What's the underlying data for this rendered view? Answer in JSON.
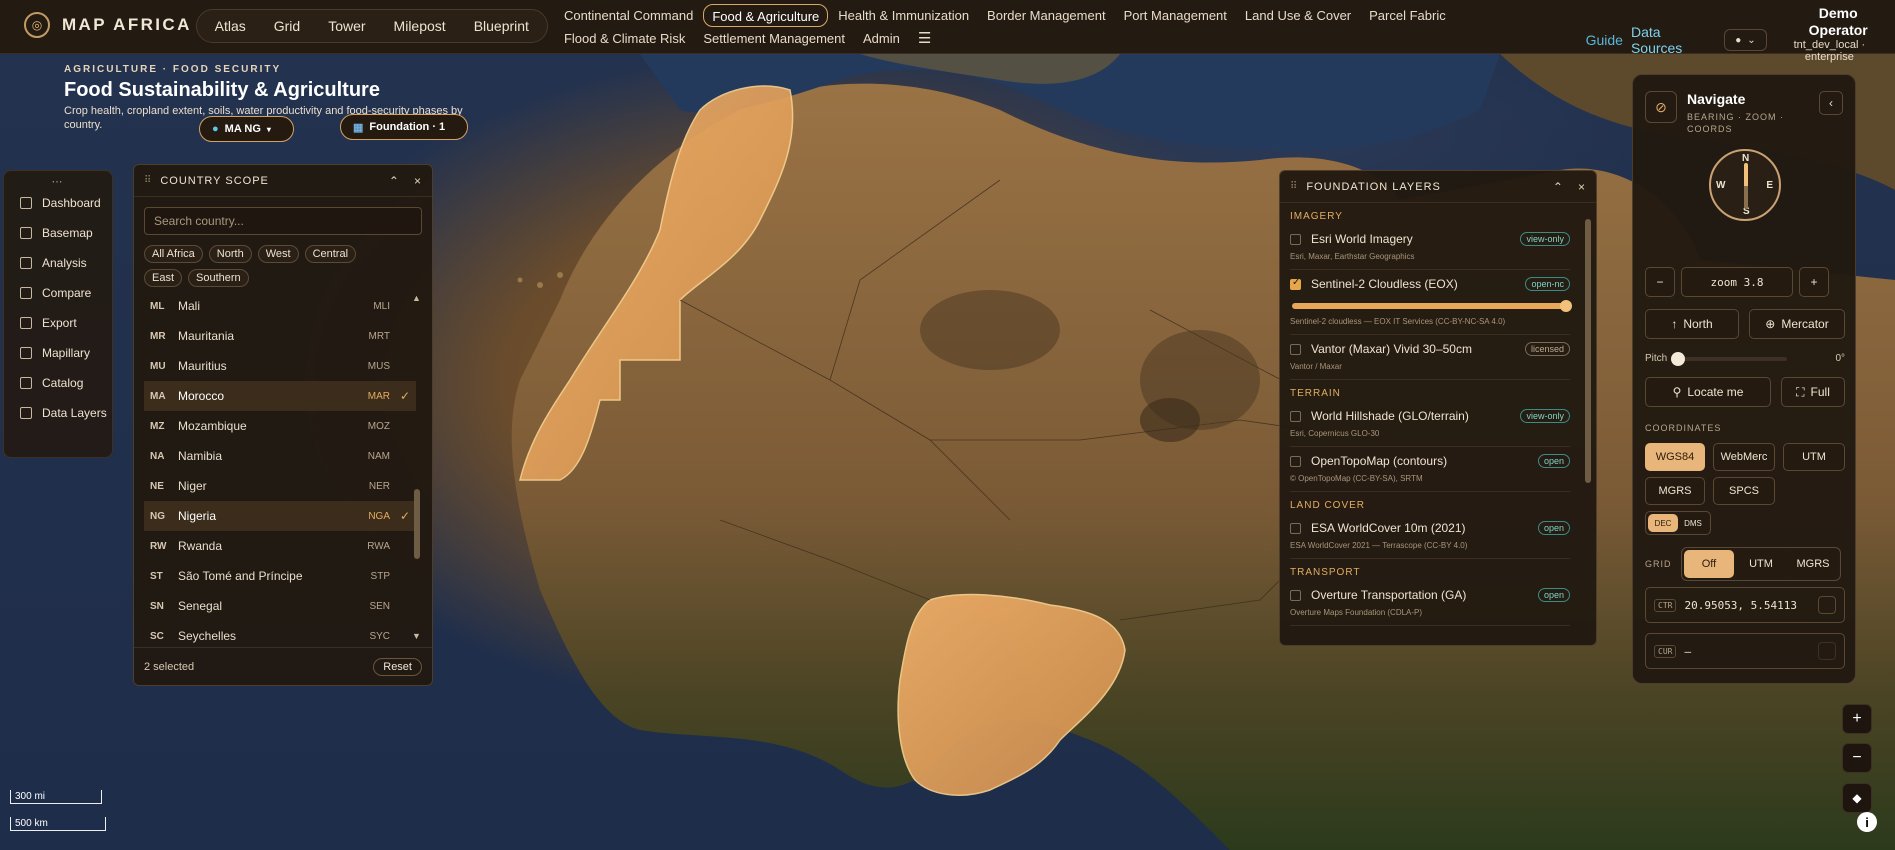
{
  "brand": {
    "title": "MAP AFRICA"
  },
  "topnav": {
    "pills": [
      "Atlas",
      "Grid",
      "Tower",
      "Milepost",
      "Blueprint"
    ],
    "tabs": [
      "Continental Command",
      "Food & Agriculture",
      "Health & Immunization",
      "Border Management",
      "Port Management",
      "Land Use & Cover",
      "Parcel Fabric",
      "Flood & Climate Risk",
      "Settlement Management",
      "Admin"
    ],
    "active_tab": "Food & Agriculture",
    "menu_icon": "hamburger-icon",
    "guide": "Guide",
    "data_sources": "Data Sources",
    "user_name": "Demo Operator",
    "user_org": "tnt_dev_local · enterprise"
  },
  "page": {
    "kicker": "AGRICULTURE · FOOD SECURITY",
    "title": "Food Sustainability & Agriculture",
    "subtitle": "Crop health, cropland extent, soils, water productivity and food-security phases by country.",
    "chip_scope": "MA NG",
    "chip_foundation": "Foundation · 1"
  },
  "rail": {
    "items": [
      {
        "label": "Dashboard",
        "icon": "dashboard-icon"
      },
      {
        "label": "Basemap",
        "icon": "basemap-icon"
      },
      {
        "label": "Analysis",
        "icon": "analysis-icon"
      },
      {
        "label": "Compare",
        "icon": "compare-icon"
      },
      {
        "label": "Export",
        "icon": "export-icon"
      },
      {
        "label": "Mapillary",
        "icon": "camera-icon"
      },
      {
        "label": "Catalog",
        "icon": "catalog-icon"
      },
      {
        "label": "Data Layers",
        "icon": "layers-icon"
      }
    ]
  },
  "scope": {
    "title": "COUNTRY SCOPE",
    "search_placeholder": "Search country...",
    "filters": [
      "All Africa",
      "North",
      "West",
      "Central",
      "East",
      "Southern"
    ],
    "countries": [
      {
        "code": "ML",
        "name": "Mali",
        "iso": "MLI",
        "selected": false
      },
      {
        "code": "MR",
        "name": "Mauritania",
        "iso": "MRT",
        "selected": false
      },
      {
        "code": "MU",
        "name": "Mauritius",
        "iso": "MUS",
        "selected": false
      },
      {
        "code": "MA",
        "name": "Morocco",
        "iso": "MAR",
        "selected": true
      },
      {
        "code": "MZ",
        "name": "Mozambique",
        "iso": "MOZ",
        "selected": false
      },
      {
        "code": "NA",
        "name": "Namibia",
        "iso": "NAM",
        "selected": false
      },
      {
        "code": "NE",
        "name": "Niger",
        "iso": "NER",
        "selected": false
      },
      {
        "code": "NG",
        "name": "Nigeria",
        "iso": "NGA",
        "selected": true
      },
      {
        "code": "RW",
        "name": "Rwanda",
        "iso": "RWA",
        "selected": false
      },
      {
        "code": "ST",
        "name": "São Tomé and Príncipe",
        "iso": "STP",
        "selected": false
      },
      {
        "code": "SN",
        "name": "Senegal",
        "iso": "SEN",
        "selected": false
      },
      {
        "code": "SC",
        "name": "Seychelles",
        "iso": "SYC",
        "selected": false
      }
    ],
    "check_mark": "✓",
    "selected_count": "2 selected",
    "reset": "Reset"
  },
  "layers": {
    "title": "FOUNDATION LAYERS",
    "sections": [
      {
        "name": "IMAGERY",
        "items": [
          {
            "name": "Esri World Imagery",
            "tag": "view-only",
            "attribution": "Esri, Maxar, Earthstar Geographics",
            "checked": false
          },
          {
            "name": "Sentinel-2 Cloudless (EOX)",
            "tag": "open-nc",
            "attribution": "Sentinel-2 cloudless — EOX IT Services (CC-BY-NC-SA 4.0)",
            "checked": true,
            "opacity": 1
          },
          {
            "name": "Vantor (Maxar) Vivid 30–50cm",
            "tag": "licensed",
            "attribution": "Vantor / Maxar",
            "checked": false
          }
        ]
      },
      {
        "name": "TERRAIN",
        "items": [
          {
            "name": "World Hillshade (GLO/terrain)",
            "tag": "view-only",
            "attribution": "Esri, Copernicus GLO-30",
            "checked": false
          },
          {
            "name": "OpenTopoMap (contours)",
            "tag": "open",
            "attribution": "© OpenTopoMap (CC-BY-SA), SRTM",
            "checked": false
          }
        ]
      },
      {
        "name": "LAND COVER",
        "items": [
          {
            "name": "ESA WorldCover 10m (2021)",
            "tag": "open",
            "attribution": "ESA WorldCover 2021 — Terrascope (CC-BY 4.0)",
            "checked": false
          }
        ]
      },
      {
        "name": "TRANSPORT",
        "items": [
          {
            "name": "Overture Transportation (GA)",
            "tag": "open",
            "attribution": "Overture Maps Foundation (CDLA-P)",
            "checked": false
          }
        ]
      }
    ]
  },
  "navigate": {
    "title": "Navigate",
    "subtitle": "BEARING · ZOOM · COORDS",
    "compass": {
      "n": "N",
      "s": "S",
      "e": "E",
      "w": "W"
    },
    "zoom_label": "zoom 3.8",
    "north": "North",
    "projection": "Mercator",
    "pitch_label": "Pitch",
    "pitch_value": "0°",
    "pitch": 0,
    "locate": "Locate me",
    "full": "Full",
    "coords_label": "COORDINATES",
    "coord_systems": [
      "WGS84",
      "WebMerc",
      "UTM",
      "MGRS",
      "SPCS"
    ],
    "coord_active": "WGS84",
    "format": [
      "DEC",
      "DMS"
    ],
    "format_active": "DEC",
    "grid_label": "GRID",
    "grid_options": [
      "Off",
      "UTM",
      "MGRS"
    ],
    "grid_active": "Off",
    "ctr_label": "CTR",
    "ctr_value": "20.95053, 5.54113",
    "cur_label": "CUR",
    "cur_value": "—"
  },
  "scale": {
    "miles": "300 mi",
    "km": "500 km"
  },
  "colors": {
    "accent": "#e2ad62",
    "panel": "#211911",
    "link": "#58b6d8"
  }
}
